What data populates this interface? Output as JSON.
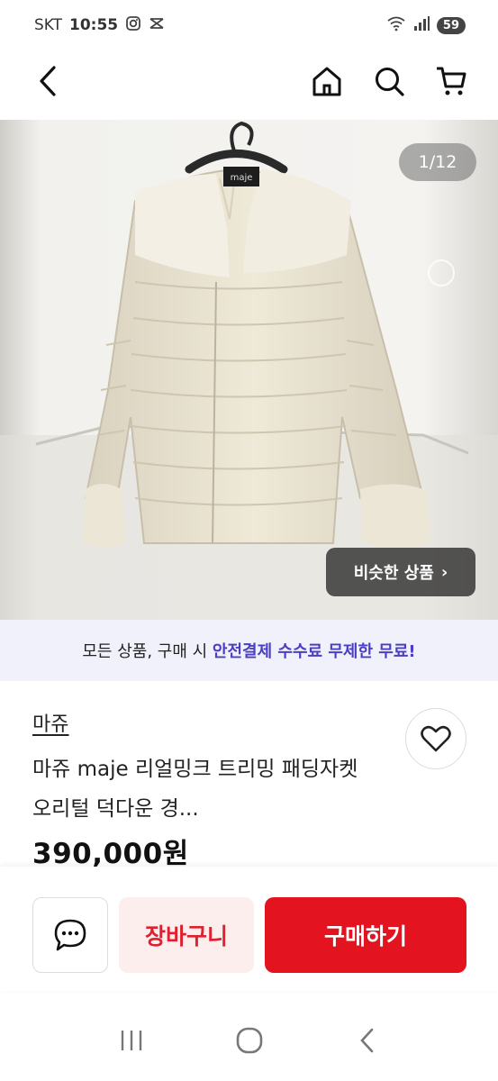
{
  "status_bar": {
    "carrier": "SKT",
    "time": "10:55",
    "battery": "59",
    "icons": [
      "instagram-icon",
      "messenger-icon",
      "wifi-icon",
      "signal-icon"
    ]
  },
  "nav": {
    "icons": [
      "back-arrow-icon",
      "home-icon",
      "search-icon",
      "cart-icon"
    ]
  },
  "gallery": {
    "counter": "1/12",
    "similar_label": "비슷한 상품",
    "similar_chevron": "›"
  },
  "promo": {
    "prefix": "모든 상품, 구매 시 ",
    "highlight": "안전결제 수수료 무제한 무료!"
  },
  "product": {
    "brand": "마쥬",
    "title": "마쥬 maje 리얼밍크 트리밍 패딩자켓 오리털 덕다운 경...",
    "price": "390,000원"
  },
  "actions": {
    "cart_label": "장바구니",
    "buy_label": "구매하기"
  },
  "colors": {
    "accent_red": "#e3131f",
    "promo_purple": "#4b3ec4"
  }
}
